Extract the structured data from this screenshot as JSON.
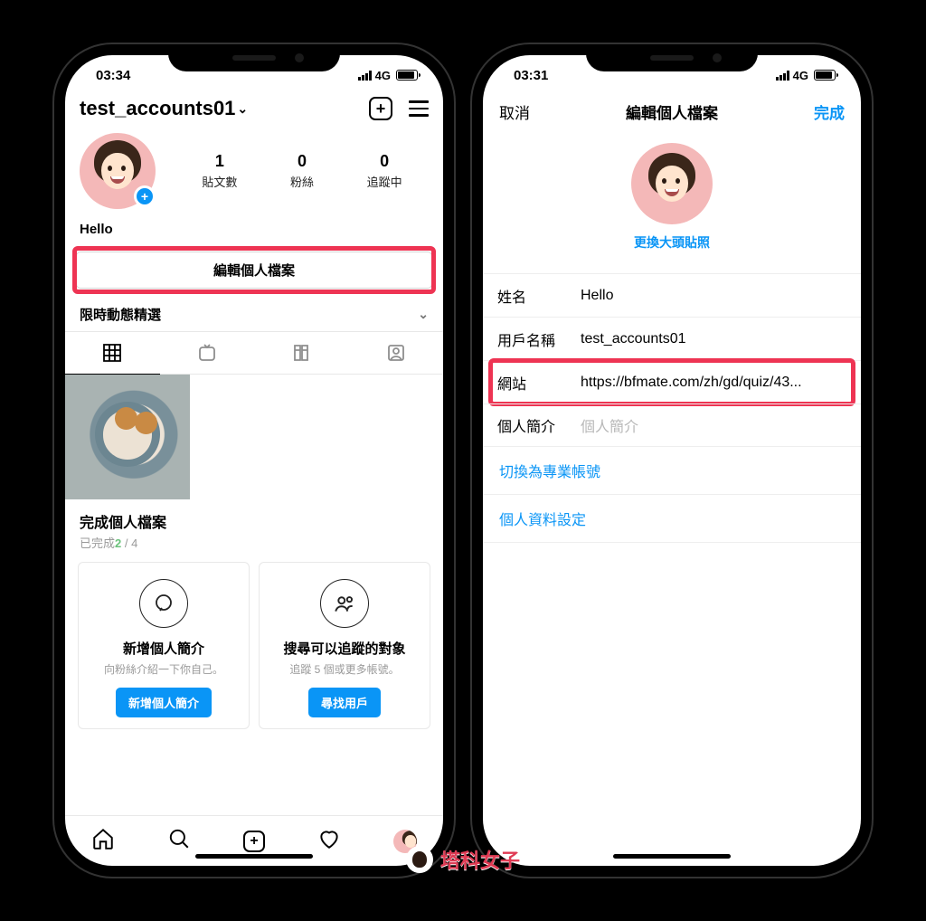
{
  "status": {
    "time_left": "03:34",
    "time_right": "03:31",
    "network": "4G"
  },
  "phone1": {
    "username": "test_accounts01",
    "stats": {
      "posts_n": "1",
      "posts_l": "貼文數",
      "followers_n": "0",
      "followers_l": "粉絲",
      "following_n": "0",
      "following_l": "追蹤中"
    },
    "display_name": "Hello",
    "edit_profile_label": "編輯個人檔案",
    "story_highlights_label": "限時動態精選",
    "complete": {
      "title": "完成個人檔案",
      "done_prefix": "已完成",
      "done_count": "2",
      "done_sep": " / ",
      "done_total": "4"
    },
    "cards": [
      {
        "title": "新增個人簡介",
        "desc": "向粉絲介紹一下你自己。",
        "button": "新增個人簡介"
      },
      {
        "title": "搜尋可以追蹤的對象",
        "desc": "追蹤 5 個或更多帳號。",
        "button": "尋找用戶"
      }
    ]
  },
  "phone2": {
    "cancel": "取消",
    "title": "編輯個人檔案",
    "done": "完成",
    "change_photo": "更換大頭貼照",
    "fields": {
      "name_label": "姓名",
      "name_value": "Hello",
      "username_label": "用戶名稱",
      "username_value": "test_accounts01",
      "website_label": "網站",
      "website_value": "https://bfmate.com/zh/gd/quiz/43...",
      "bio_label": "個人簡介",
      "bio_placeholder": "個人簡介"
    },
    "switch_pro": "切換為專業帳號",
    "personal_settings": "個人資料設定"
  },
  "watermark": "塔科女子"
}
